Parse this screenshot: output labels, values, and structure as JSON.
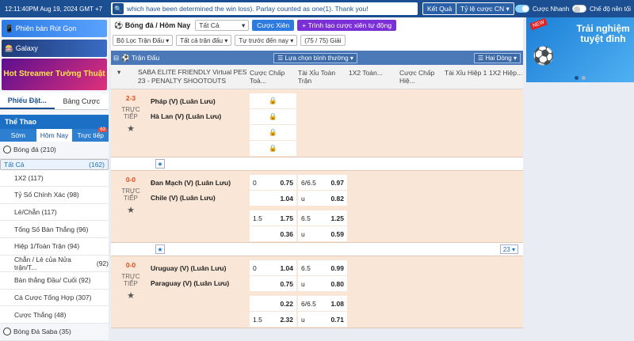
{
  "topbar": {
    "datetime": "12:11:40PM Aug 19, 2024 GMT +7",
    "marquee": "which have been determined the win loss). Parlay counted as one(1). Thank you!",
    "results": "Kết Quả",
    "odds_type": "Tỷ lệ cược CN",
    "quick_bet": "Cược Nhanh",
    "night_mode": "Chế độ nền tối"
  },
  "sidebar": {
    "version_banner": "Phiên bản Rút Gọn",
    "galaxy_banner": "Galaxy",
    "streamer_banner": "Hot Streamer Tường Thuật",
    "tabs": [
      "Phiếu Đặt...",
      "Bảng Cược"
    ],
    "sport_header": "Thể Thao",
    "subtabs": [
      "Sớm",
      "Hôm Nay",
      "Trực tiếp"
    ],
    "live_badge": "63",
    "items": [
      {
        "label": "Bóng đá",
        "count": "(210)"
      },
      {
        "label": "Tất Cả",
        "count": "(162)"
      },
      {
        "label": "1X2",
        "count": "(117)"
      },
      {
        "label": "Tỷ Số Chính Xác",
        "count": "(98)"
      },
      {
        "label": "Lẻ/Chẵn",
        "count": "(117)"
      },
      {
        "label": "Tổng Số Bàn Thắng",
        "count": "(96)"
      },
      {
        "label": "Hiệp 1/Toàn Trận",
        "count": "(94)"
      },
      {
        "label": "Chẵn / Lẻ của Nửa trận/T...",
        "count": "(92)"
      },
      {
        "label": "Bàn thắng Đầu/ Cuối",
        "count": "(92)"
      },
      {
        "label": "Cá Cược Tổng Hợp",
        "count": "(307)"
      },
      {
        "label": "Cược Thắng",
        "count": "(48)"
      },
      {
        "label": "Bóng Đá Saba",
        "count": "(35)"
      }
    ]
  },
  "main": {
    "breadcrumb": "Bóng đá / Hôm Nay",
    "filter_all": "Tất Cả",
    "parlay_button": "Cược Xiên",
    "parlay_builder_button": "Trình tạo cược xiên tự động",
    "filter_league": "Bộ Lọc Trận Đấu",
    "filter_all_matches": "Tất cả trận đấu",
    "filter_before": "Tự trước đến nay",
    "count": "(75 / 75) Giải",
    "section_title": "Trận Đấu",
    "sort_select": "Lựa chọn bình thường",
    "lines_select": "Hai Dòng",
    "league": "SABA ELITE FRIENDLY Virtual PES 23 - PENALTY SHOOTOUTS",
    "columns": [
      "Cược Chấp Toà...",
      "Tài Xỉu Toàn Trận",
      "1X2 Toàn...",
      "Cược Chấp Hiệ...",
      "Tài Xỉu Hiệp 1",
      "1X2 Hiệp..."
    ],
    "more_count": "23",
    "live_label": "TRỰC TIẾP",
    "matches": [
      {
        "score": "2-3",
        "home": "Pháp (V) (Luân Lưu)",
        "away": "Hà Lan (V) (Luân Lưu)",
        "rows": []
      },
      {
        "score": "0-0",
        "home": "Đan Mạch (V) (Luân Lưu)",
        "away": "Chile (V) (Luân Lưu)",
        "rows": [
          {
            "h1": "0",
            "v1": "0.75",
            "h2": "6/6.5",
            "v2": "0.97"
          },
          {
            "h1": "",
            "v1": "1.04",
            "h2": "u",
            "v2": "0.82"
          },
          {
            "h1": "1.5",
            "v1": "1.75",
            "h2": "6.5",
            "v2": "1.25"
          },
          {
            "h1": "",
            "v1": "0.36",
            "h2": "u",
            "v2": "0.59"
          }
        ]
      },
      {
        "score": "0-0",
        "home": "Uruguay (V) (Luân Lưu)",
        "away": "Paraguay (V) (Luân Lưu)",
        "rows": [
          {
            "h1": "0",
            "v1": "1.04",
            "h2": "6.5",
            "v2": "0.99"
          },
          {
            "h1": "",
            "v1": "0.75",
            "h2": "u",
            "v2": "0.80"
          },
          {
            "h1": "",
            "v1": "0.22",
            "h2": "6/6.5",
            "v2": "1.08"
          },
          {
            "h1": "1.5",
            "v1": "2.32",
            "h2": "u",
            "v2": "0.71"
          }
        ]
      }
    ]
  },
  "promo": {
    "new_badge": "NEW",
    "text": "Trải nghiệm tuyệt đỉnh"
  }
}
